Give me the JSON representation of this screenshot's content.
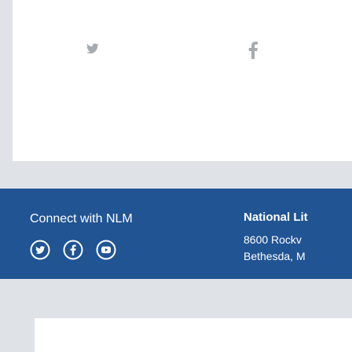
{
  "share": {
    "twitter_icon": "twitter-icon",
    "facebook_icon": "facebook-icon"
  },
  "footer": {
    "connect_title": "Connect with NLM",
    "social": [
      {
        "name": "twitter",
        "icon": "twitter-icon"
      },
      {
        "name": "facebook",
        "icon": "facebook-icon"
      },
      {
        "name": "youtube",
        "icon": "youtube-icon"
      }
    ],
    "org_name": "National Lit",
    "address_line1": "8600 Rockv",
    "address_line2": "Bethesda, M"
  },
  "colors": {
    "footer_bg": "#205493",
    "band_bg": "#dfe3e8",
    "icon_gray": "#9aa0a6"
  }
}
